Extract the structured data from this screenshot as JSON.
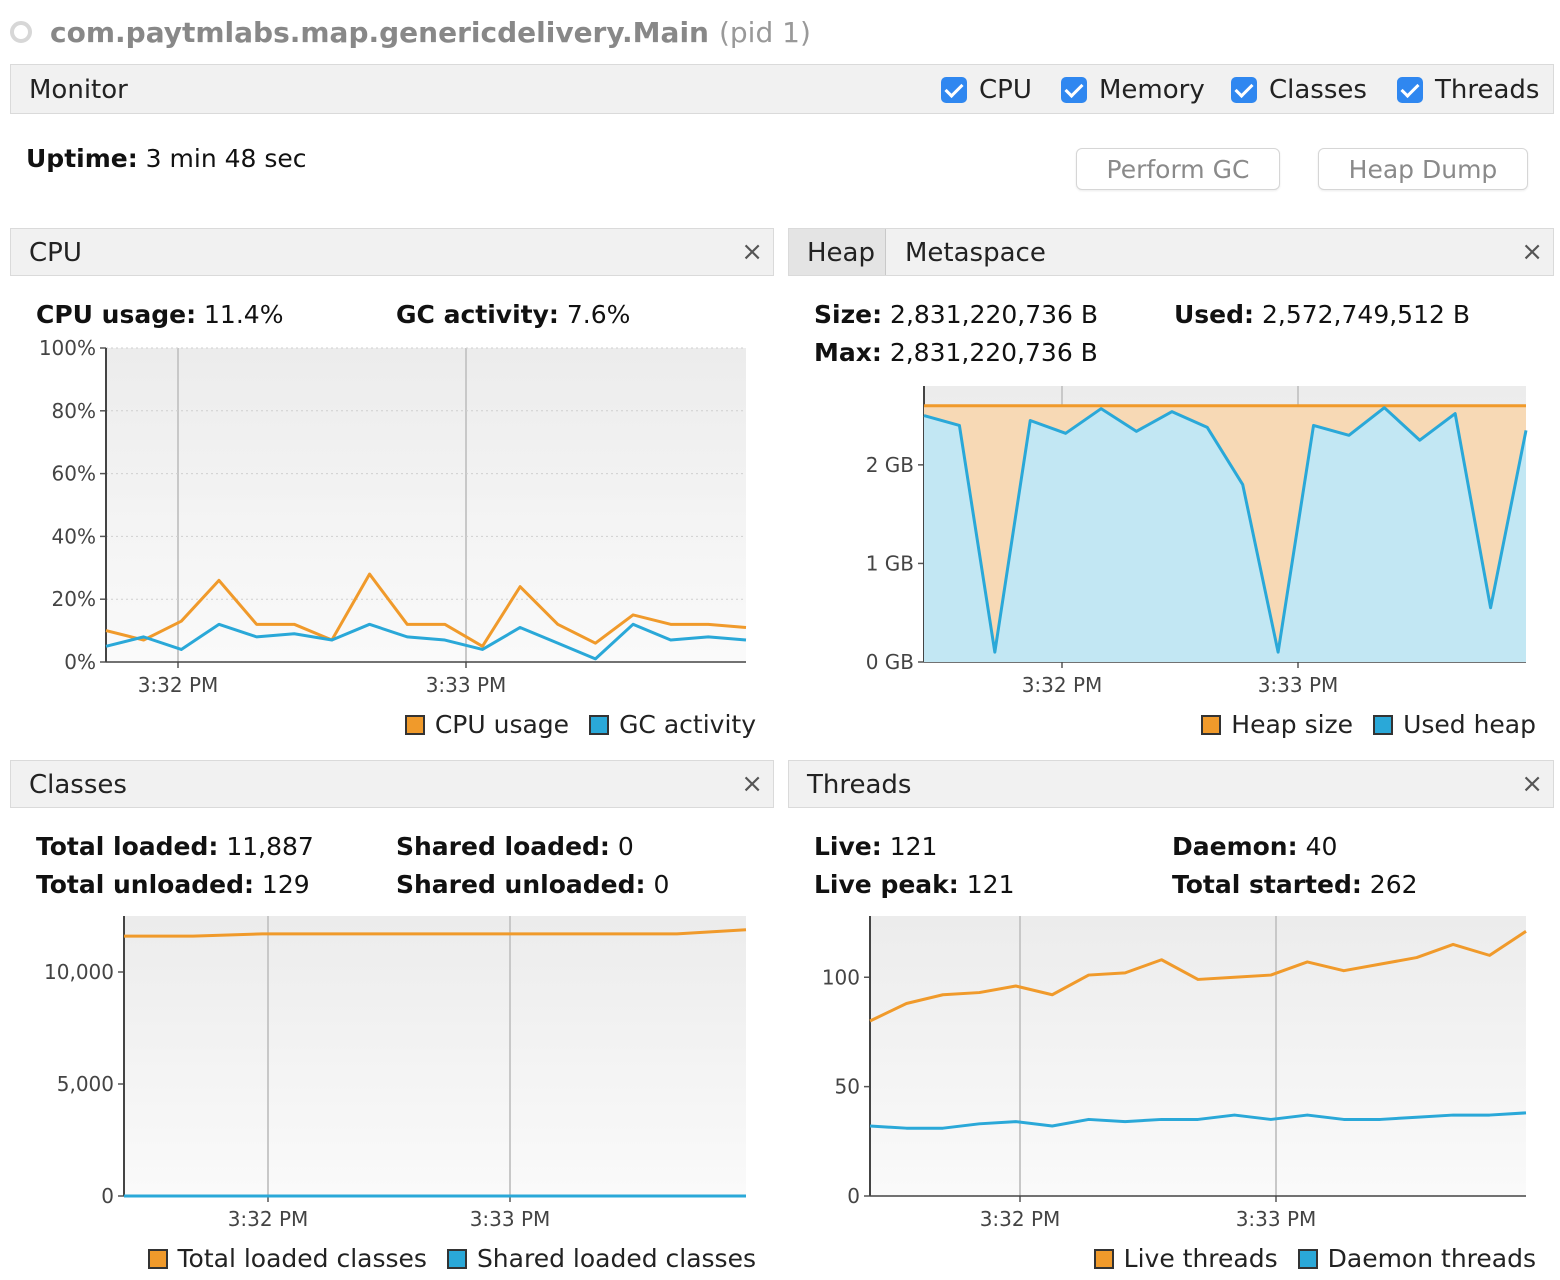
{
  "window": {
    "app_name": "com.paytmlabs.map.genericdelivery.Main",
    "pid": "(pid 1)"
  },
  "monitor": {
    "label": "Monitor",
    "checkboxes": [
      {
        "label": "CPU",
        "checked": true
      },
      {
        "label": "Memory",
        "checked": true
      },
      {
        "label": "Classes",
        "checked": true
      },
      {
        "label": "Threads",
        "checked": true
      }
    ],
    "uptime_label": "Uptime:",
    "uptime_value": "3 min 48 sec",
    "perform_gc_label": "Perform GC",
    "heap_dump_label": "Heap Dump"
  },
  "colors": {
    "orange": "#f09a2b",
    "blue": "#2aa8d8",
    "heap_fill": "#f7d9b5",
    "used_fill": "#bfe8f7"
  },
  "cpu_panel": {
    "title": "CPU",
    "close": "×",
    "stats": [
      {
        "label": "CPU usage:",
        "value": "11.4%"
      },
      {
        "label": "GC activity:",
        "value": "7.6%"
      }
    ],
    "legend": [
      "CPU usage",
      "GC activity"
    ]
  },
  "memory_panel": {
    "tabs": [
      "Heap",
      "Metaspace"
    ],
    "close": "×",
    "stats": [
      {
        "label": "Size:",
        "value": "2,831,220,736 B"
      },
      {
        "label": "Used:",
        "value": "2,572,749,512 B"
      },
      {
        "label": "Max:",
        "value": "2,831,220,736 B"
      }
    ],
    "legend": [
      "Heap size",
      "Used heap"
    ]
  },
  "classes_panel": {
    "title": "Classes",
    "close": "×",
    "stats": [
      {
        "label": "Total loaded:",
        "value": "11,887"
      },
      {
        "label": "Shared loaded:",
        "value": "0"
      },
      {
        "label": "Total unloaded:",
        "value": "129"
      },
      {
        "label": "Shared unloaded:",
        "value": "0"
      }
    ],
    "legend": [
      "Total loaded classes",
      "Shared loaded classes"
    ]
  },
  "threads_panel": {
    "title": "Threads",
    "close": "×",
    "stats": [
      {
        "label": "Live:",
        "value": "121"
      },
      {
        "label": "Daemon:",
        "value": "40"
      },
      {
        "label": "Live peak:",
        "value": "121"
      },
      {
        "label": "Total started:",
        "value": "262"
      }
    ],
    "legend": [
      "Live threads",
      "Daemon threads"
    ]
  },
  "chart_data": [
    {
      "id": "cpu",
      "type": "line",
      "x_ticks": [
        "3:32 PM",
        "3:33 PM"
      ],
      "y_ticks": [
        "0%",
        "20%",
        "40%",
        "60%",
        "80%",
        "100%"
      ],
      "ylim": [
        0,
        100
      ],
      "grid": true,
      "legend_position": "bottom-right",
      "series": [
        {
          "name": "CPU usage",
          "color": "#f09a2b",
          "values": [
            10,
            7,
            13,
            26,
            12,
            12,
            7,
            28,
            12,
            12,
            5,
            24,
            12,
            6,
            15,
            12,
            12,
            11
          ]
        },
        {
          "name": "GC activity",
          "color": "#2aa8d8",
          "values": [
            5,
            8,
            4,
            12,
            8,
            9,
            7,
            12,
            8,
            7,
            4,
            11,
            6,
            1,
            12,
            7,
            8,
            7
          ]
        }
      ]
    },
    {
      "id": "heap",
      "type": "area",
      "x_ticks": [
        "3:32 PM",
        "3:33 PM"
      ],
      "y_ticks": [
        "0 GB",
        "1 GB",
        "2 GB"
      ],
      "ylim": [
        0,
        2.8
      ],
      "grid": true,
      "legend_position": "bottom-right",
      "series": [
        {
          "name": "Heap size",
          "color": "#f09a2b",
          "values": [
            2.6,
            2.6,
            2.6,
            2.6,
            2.6,
            2.6,
            2.6,
            2.6,
            2.6,
            2.6,
            2.6,
            2.6,
            2.6,
            2.6,
            2.6,
            2.6,
            2.6,
            2.6,
            2.6,
            2.6,
            2.6,
            2.6
          ]
        },
        {
          "name": "Used heap",
          "color": "#2aa8d8",
          "values": [
            2.5,
            2.4,
            0.1,
            2.45,
            2.32,
            2.57,
            2.34,
            2.54,
            2.38,
            1.8,
            0.1,
            2.4,
            2.3,
            2.58,
            2.25,
            2.52,
            0.55,
            2.35
          ]
        }
      ]
    },
    {
      "id": "classes",
      "type": "line",
      "x_ticks": [
        "3:32 PM",
        "3:33 PM"
      ],
      "y_ticks": [
        "0",
        "5,000",
        "10,000"
      ],
      "ylim": [
        0,
        12500
      ],
      "grid": true,
      "legend_position": "bottom-right",
      "series": [
        {
          "name": "Total loaded classes",
          "color": "#f09a2b",
          "values": [
            11600,
            11600,
            11700,
            11700,
            11700,
            11700,
            11700,
            11700,
            11700,
            11887
          ]
        },
        {
          "name": "Shared loaded classes",
          "color": "#2aa8d8",
          "values": [
            0,
            0,
            0,
            0,
            0,
            0,
            0,
            0,
            0,
            0
          ]
        }
      ]
    },
    {
      "id": "threads",
      "type": "line",
      "x_ticks": [
        "3:32 PM",
        "3:33 PM"
      ],
      "y_ticks": [
        "0",
        "50",
        "100"
      ],
      "ylim": [
        0,
        128
      ],
      "grid": true,
      "legend_position": "bottom-right",
      "series": [
        {
          "name": "Live threads",
          "color": "#f09a2b",
          "values": [
            80,
            88,
            92,
            93,
            96,
            92,
            101,
            102,
            108,
            99,
            100,
            101,
            107,
            103,
            106,
            109,
            115,
            110,
            121
          ]
        },
        {
          "name": "Daemon threads",
          "color": "#2aa8d8",
          "values": [
            32,
            31,
            31,
            33,
            34,
            32,
            35,
            34,
            35,
            35,
            37,
            35,
            37,
            35,
            35,
            36,
            37,
            37,
            38
          ]
        }
      ]
    }
  ]
}
